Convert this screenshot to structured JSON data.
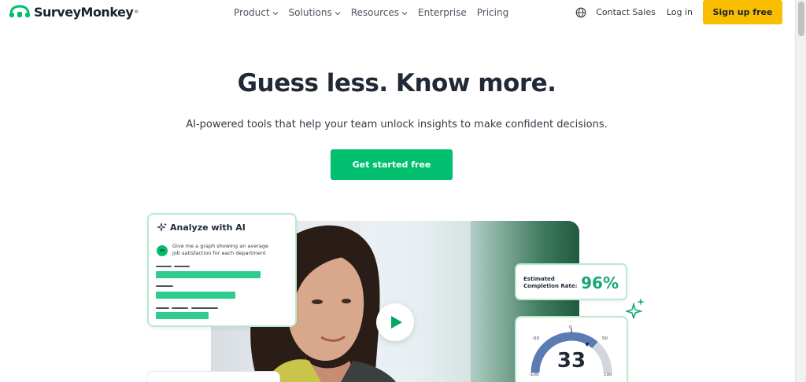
{
  "nav": {
    "brand": "SurveyMonkey",
    "menu": [
      {
        "label": "Product",
        "has_dropdown": true
      },
      {
        "label": "Solutions",
        "has_dropdown": true
      },
      {
        "label": "Resources",
        "has_dropdown": true
      },
      {
        "label": "Enterprise",
        "has_dropdown": false
      },
      {
        "label": "Pricing",
        "has_dropdown": false
      }
    ],
    "language_icon": "globe-icon",
    "contact_sales": "Contact Sales",
    "login": "Log in",
    "signup": "Sign up free"
  },
  "hero": {
    "headline": "Guess less. Know more.",
    "subheadline": "AI-powered tools that help your team unlock insights to make confident decisions.",
    "cta": "Get started free"
  },
  "visual": {
    "ai_card": {
      "title": "Analyze with AI",
      "prompt": "Give me a graph showing an average job satisfaction for each department"
    },
    "completion_card": {
      "label": "Estimated Completion Rate:",
      "value": "96%"
    },
    "gauge_card": {
      "value": "33",
      "ticks": [
        "-50",
        "0",
        "50",
        "-100",
        "100"
      ]
    },
    "play_icon": "play-icon"
  },
  "colors": {
    "brand_green": "#00bf6f",
    "signup_yellow": "#f9be00",
    "accent_teal": "#17a773",
    "text_dark": "#1f2a36"
  }
}
